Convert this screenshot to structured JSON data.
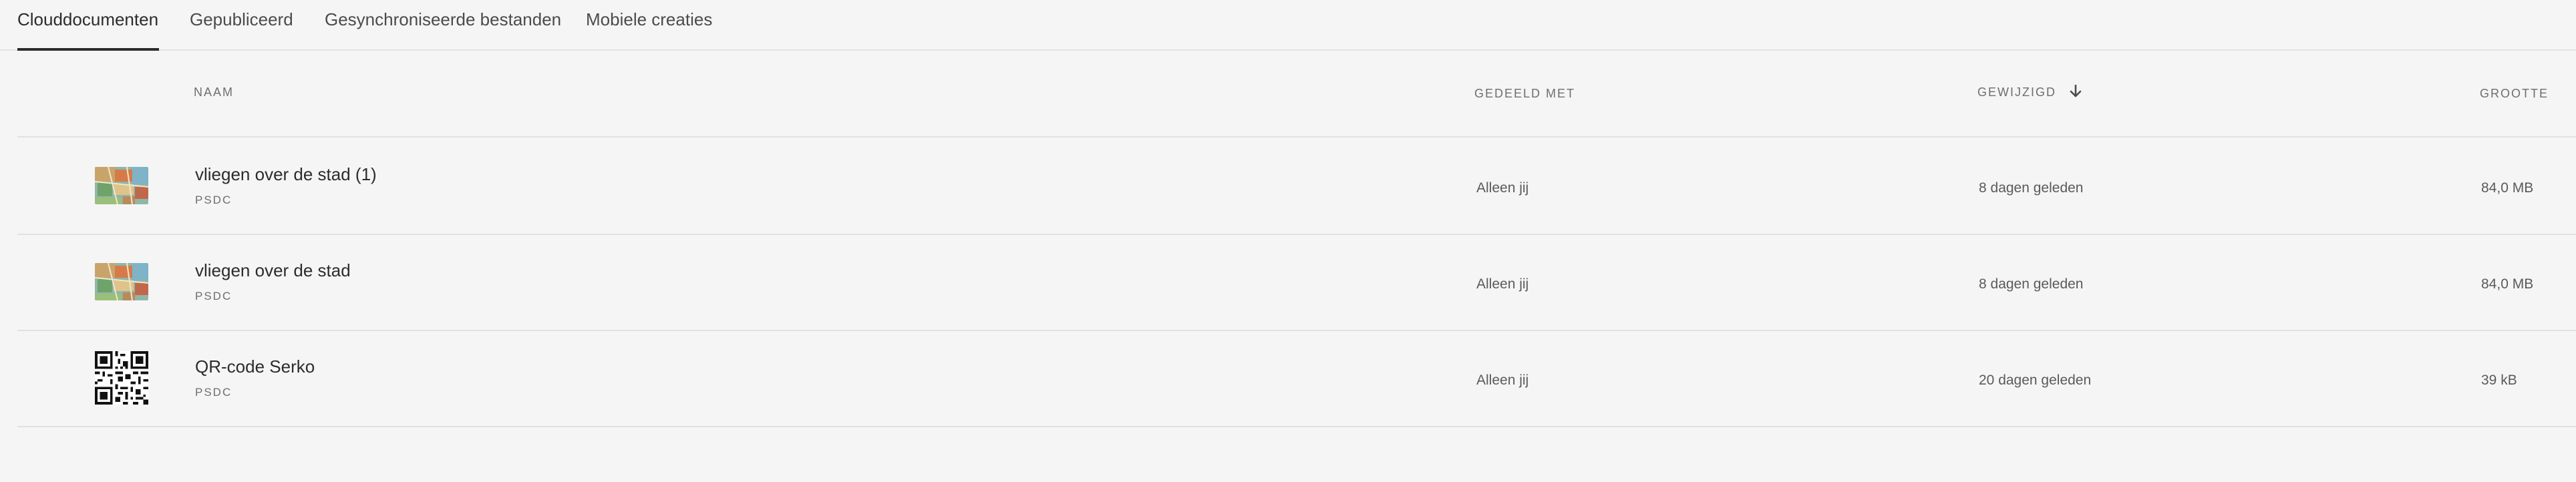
{
  "tabs": [
    {
      "label": "Clouddocumenten",
      "active": true
    },
    {
      "label": "Gepubliceerd",
      "active": false
    },
    {
      "label": "Gesynchroniseerde bestanden",
      "active": false
    },
    {
      "label": "Mobiele creaties",
      "active": false
    }
  ],
  "table": {
    "headers": {
      "name": "NAAM",
      "shared_with": "GEDEELD MET",
      "modified": "GEWIJZIGD",
      "size": "GROOTTE"
    },
    "sort_icon": "arrow-down-icon",
    "rows": [
      {
        "name": "vliegen over de stad (1)",
        "type": "PSDC",
        "shared_with": "Alleen jij",
        "modified": "8 dagen geleden",
        "size": "84,0 MB",
        "thumbnail": "map-artwork-thumbnail"
      },
      {
        "name": "vliegen over de stad",
        "type": "PSDC",
        "shared_with": "Alleen jij",
        "modified": "8 dagen geleden",
        "size": "84,0 MB",
        "thumbnail": "map-artwork-thumbnail"
      },
      {
        "name": "QR-code Serko",
        "type": "PSDC",
        "shared_with": "Alleen jij",
        "modified": "20 dagen geleden",
        "size": "39 kB",
        "thumbnail": "qr-code-thumbnail"
      }
    ]
  }
}
